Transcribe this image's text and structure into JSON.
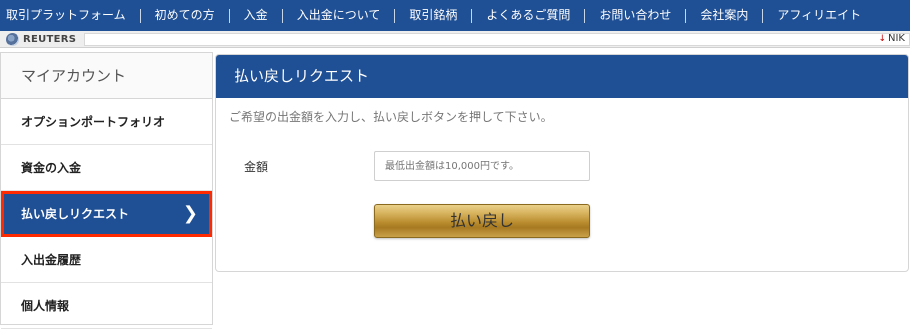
{
  "topnav": {
    "items": [
      "取引プラットフォーム",
      "初めての方",
      "入金",
      "入出金について",
      "取引銘柄",
      "よくあるご質問",
      "お問い合わせ",
      "会社案内",
      "アフィリエイト"
    ]
  },
  "ticker": {
    "logo_text": "REUTERS",
    "quote_text": "NIK"
  },
  "sidebar": {
    "title": "マイアカウント",
    "items": [
      {
        "label": "オプションポートフォリオ"
      },
      {
        "label": "資金の入金"
      },
      {
        "label": "払い戻しリクエスト"
      },
      {
        "label": "入出金履歴"
      },
      {
        "label": "個人情報"
      }
    ],
    "chevron": "❯"
  },
  "panel": {
    "title": "払い戻しリクエスト",
    "description": "ご希望の出金額を入力し、払い戻しボタンを押して下さい。",
    "amount_label": "金額",
    "amount_placeholder": "最低出金額は10,000円です。",
    "amount_value": "",
    "submit_label": "払い戻し"
  },
  "colors": {
    "nav_blue": "#1f4f94",
    "highlight_red": "#ff2a00",
    "gold": "#c9a048"
  }
}
